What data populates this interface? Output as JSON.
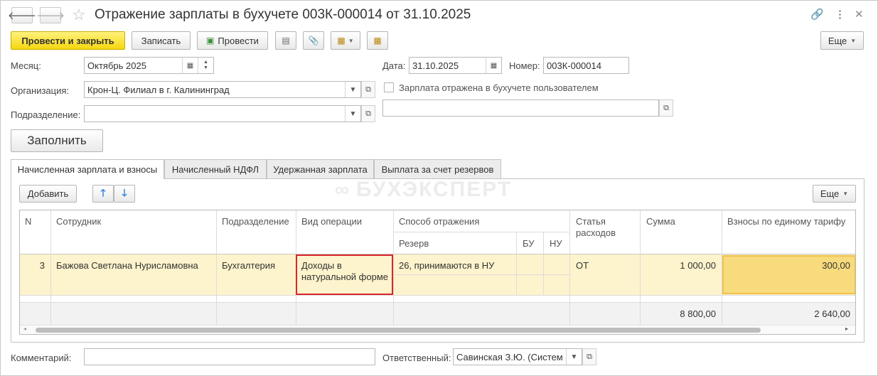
{
  "window": {
    "title": "Отражение зарплаты в бухучете 003К-000014 от 31.10.2025",
    "back_icon": "arrow-left-icon",
    "forward_icon": "arrow-right-icon",
    "star_icon": "star-icon",
    "link_icon": "link-icon",
    "menu_icon": "more-vertical-icon",
    "close_icon": "close-icon"
  },
  "toolbar": {
    "post_close_label": "Провести и закрыть",
    "save_label": "Записать",
    "post_label": "Провести",
    "more_label": "Еще"
  },
  "form": {
    "month_label": "Месяц:",
    "month_value": "Октябрь 2025",
    "date_label": "Дата:",
    "date_value": "31.10.2025",
    "number_label": "Номер:",
    "number_value": "003К-000014",
    "org_label": "Организация:",
    "org_value": "Крон-Ц. Филиал в г. Калининград",
    "user_reflected_label": "Зарплата отражена в бухучете пользователем",
    "dept_label": "Подразделение:",
    "dept_value": "",
    "extra_value": "",
    "fill_label": "Заполнить"
  },
  "tabs": [
    {
      "label": "Начисленная зарплата и взносы",
      "active": true
    },
    {
      "label": "Начисленный НДФЛ",
      "active": false
    },
    {
      "label": "Удержанная зарплата",
      "active": false
    },
    {
      "label": "Выплата за счет резервов",
      "active": false
    }
  ],
  "table_toolbar": {
    "add_label": "Добавить",
    "more_label": "Еще"
  },
  "watermark": "БУХЭКСПЕРТ",
  "table": {
    "headers": {
      "n": "N",
      "employee": "Сотрудник",
      "department": "Подразделение",
      "operation": "Вид операции",
      "method": "Способ отражения",
      "reserve": "Резерв",
      "bu": "БУ",
      "nu": "НУ",
      "expense_1": "Статья",
      "expense_2": "расходов",
      "sum": "Сумма",
      "contrib": "Взносы по единому тарифу"
    },
    "rows": [
      {
        "n": "3",
        "employee": "Бажова Светлана Нурисламовна",
        "department": "Бухгалтерия",
        "operation_1": "Доходы в",
        "operation_2": "натуральной форме",
        "method": "26, принимаются в НУ",
        "expense": "ОТ",
        "sum": "1 000,00",
        "contrib": "300,00"
      }
    ],
    "totals": {
      "sum": "8 800,00",
      "contrib": "2 640,00"
    }
  },
  "footer": {
    "comment_label": "Комментарий:",
    "comment_value": "",
    "responsible_label": "Ответственный:",
    "responsible_value": "Савинская З.Ю. (Систем"
  },
  "colors": {
    "primary_button": "#f6d70f",
    "selected_row": "#fdf3cc",
    "selected_cell": "#f7db7c",
    "highlight_border": "#d9262b"
  }
}
